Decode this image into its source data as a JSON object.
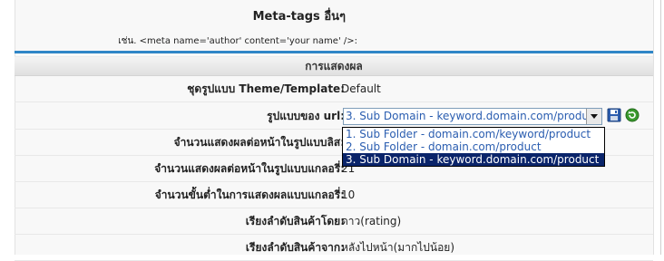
{
  "meta": {
    "label": "Meta-tags อื่นๆ",
    "example": "เช่น. <meta name='author' content='your name' />:"
  },
  "section": {
    "title": "การแสดงผล"
  },
  "rows": {
    "theme": {
      "label": "ชุดรูปแบบ Theme/Template:",
      "value": "Default"
    },
    "url_format": {
      "label": "รูปแบบของ url:"
    },
    "list_count": {
      "label": "จำนวนแสดงผลต่อหน้าในรูปแบบลิส:"
    },
    "gallery_count": {
      "label": "จำนวนแสดงผลต่อหน้าในรูปแบบแกลอรี่:",
      "value": "21"
    },
    "gallery_min": {
      "label": "จำนวนขั้นต่ำในการแสดงผลแบบแกลอรี่:",
      "value": "10"
    },
    "sort_by": {
      "label": "เรียงลำดับสินค้าโดย:",
      "value": "ดาว(rating)"
    },
    "sort_order": {
      "label": "เรียงลำดับสินค้าจาก:",
      "value": "หลังไปหน้า(มากไปน้อย)"
    }
  },
  "url_select": {
    "selected": "3. Sub Domain - keyword.domain.com/product",
    "options": [
      "1. Sub Folder - domain.com/keyword/product",
      "2. Sub Folder - domain.com/product",
      "3. Sub Domain - keyword.domain.com/product"
    ]
  },
  "icons": {
    "save": "save-icon",
    "refresh": "refresh-icon"
  },
  "colors": {
    "accent_line": "#2f86c7",
    "option_text": "#2a5db0",
    "selected_bg": "#0a246a"
  }
}
